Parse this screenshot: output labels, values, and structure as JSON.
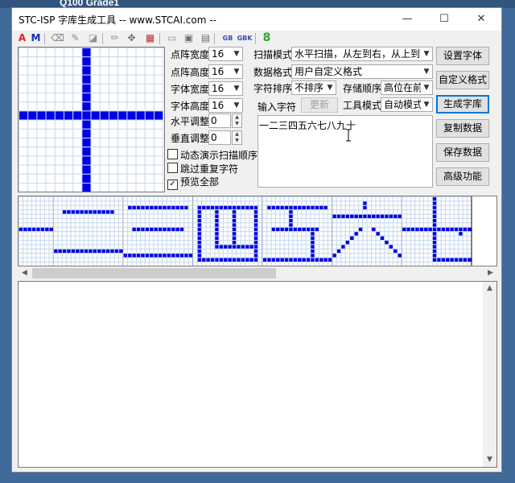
{
  "background": {
    "behind_window_text": "Q100 Grade1"
  },
  "window": {
    "title": "STC-ISP 字库生成工具 -- www.STCAI.com --",
    "minimize_glyph": "—",
    "maximize_glyph": "☐",
    "close_glyph": "✕"
  },
  "toolbar": {
    "items": [
      {
        "name": "font-color-a-icon",
        "glyph": "A",
        "color": "#e02020"
      },
      {
        "name": "mode-m-icon",
        "glyph": "M",
        "color": "#1030c0"
      },
      {
        "name": "eraser-icon",
        "glyph": "⌫",
        "color": "#909090"
      },
      {
        "name": "paint-icon",
        "glyph": "✎",
        "color": "#909090"
      },
      {
        "name": "bucket-icon",
        "glyph": "◪",
        "color": "#909090"
      },
      {
        "name": "pen-icon",
        "glyph": "✏",
        "color": "#909090"
      },
      {
        "name": "move-icon",
        "glyph": "✥",
        "color": "#707070"
      },
      {
        "name": "palette-icon",
        "glyph": "▦",
        "color": "#c03030"
      },
      {
        "name": "open-icon",
        "glyph": "▭",
        "color": "#909090"
      },
      {
        "name": "save-icon",
        "glyph": "▣",
        "color": "#707070"
      },
      {
        "name": "save-as-icon",
        "glyph": "▤",
        "color": "#707070"
      },
      {
        "name": "gb2312-icon",
        "glyph": "GB",
        "color": "#3050b0"
      },
      {
        "name": "gbk-icon",
        "glyph": "GBK",
        "color": "#3050b0"
      },
      {
        "name": "digit-8-icon",
        "glyph": "8",
        "color": "#20b020"
      }
    ]
  },
  "params": {
    "dot_width_label": "点阵宽度",
    "dot_width": "16",
    "dot_height_label": "点阵高度",
    "dot_height": "16",
    "char_width_label": "字体宽度",
    "char_width": "16",
    "char_height_label": "字体高度",
    "char_height": "16",
    "h_adjust_label": "水平调整",
    "h_adjust": "0",
    "v_adjust_label": "垂直调整",
    "v_adjust": "0",
    "scan_mode_label": "扫描模式",
    "scan_mode": "水平扫描，从左到右，从上到下",
    "data_format_label": "数据格式",
    "data_format": "用户自定义格式",
    "char_sort_label": "字符排序",
    "char_sort": "不排序",
    "store_order_label": "存储顺序",
    "store_order": "高位在前",
    "input_chars_label": "输入字符",
    "update_button": "更新",
    "tool_mode_label": "工具模式",
    "tool_mode": "自动模式"
  },
  "options": {
    "animate_scan": {
      "label": "动态演示扫描顺序",
      "checked": false
    },
    "skip_repeat": {
      "label": "跳过重复字符",
      "checked": false
    },
    "preview_all": {
      "label": "预览全部",
      "checked": true
    }
  },
  "input_text": "一二三四五六七八九十",
  "buttons": {
    "set_font": "设置字体",
    "custom_format": "自定义格式",
    "generate": "生成字库",
    "copy_data": "复制数据",
    "save_data": "保存数据",
    "advanced": "高级功能"
  },
  "colors": {
    "pixel_on": "#0000e6",
    "grid": "#c8daf0",
    "focus": "#0078d7"
  }
}
